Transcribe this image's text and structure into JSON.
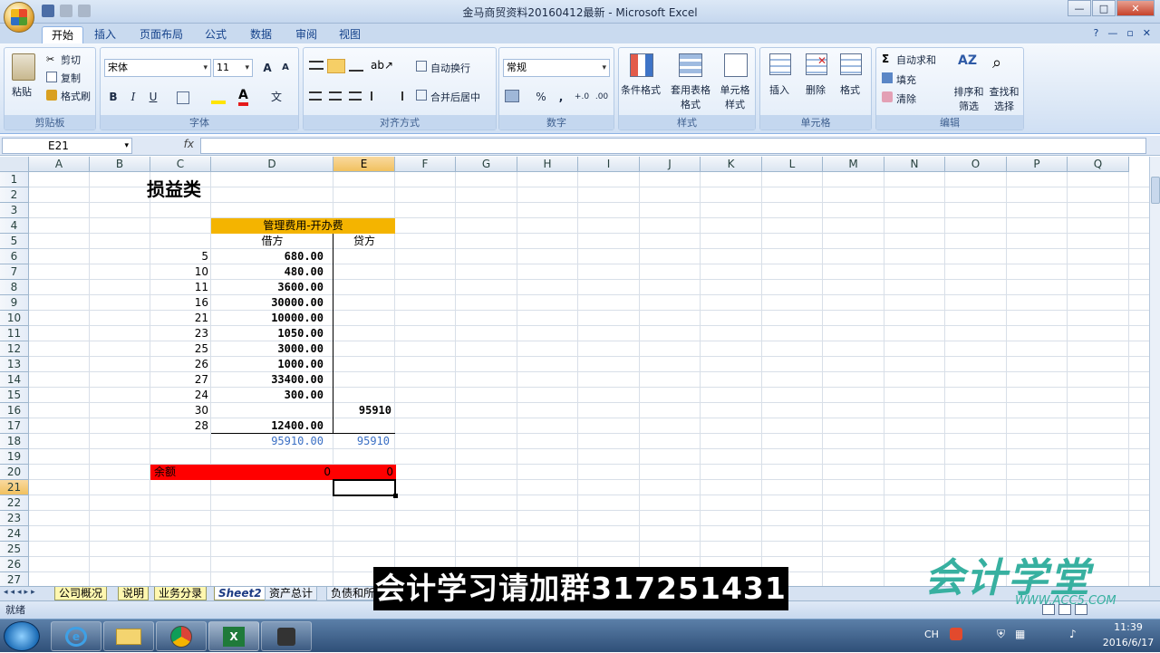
{
  "window": {
    "title": "金马商贸资料20160412最新 - Microsoft Excel",
    "controls": [
      "—",
      "□",
      "✕"
    ]
  },
  "ribbon_tabs": [
    "开始",
    "插入",
    "页面布局",
    "公式",
    "数据",
    "审阅",
    "视图"
  ],
  "ribbon": {
    "clipboard": {
      "paste": "粘贴",
      "cut": "剪切",
      "copy": "复制",
      "format_painter": "格式刷",
      "label": "剪贴板"
    },
    "font": {
      "name": "宋体",
      "size": "11",
      "grow": "A",
      "shrink": "A",
      "bold": "B",
      "italic": "I",
      "underline": "U",
      "label": "字体",
      "phonetic": "文"
    },
    "alignment": {
      "wrap": "自动换行",
      "merge": "合并后居中",
      "label": "对齐方式"
    },
    "number": {
      "format": "常规",
      "percent": "%",
      "comma": ",",
      "inc_dec": "+.0",
      "dec_dec": ".00",
      "label": "数字"
    },
    "styles": {
      "conditional": "条件格式",
      "table": "套用表格格式",
      "cell": "单元格样式",
      "label": "样式"
    },
    "cells": {
      "insert": "插入",
      "delete": "删除",
      "format": "格式",
      "label": "单元格"
    },
    "editing": {
      "autosum": "自动求和",
      "fill": "填充",
      "clear": "清除",
      "sort": "排序和筛选",
      "find": "查找和选择",
      "label": "编辑"
    }
  },
  "formula_bar": {
    "name_box": "E21",
    "fx": "fx",
    "value": ""
  },
  "columns": [
    "A",
    "B",
    "C",
    "D",
    "E",
    "F",
    "G",
    "H",
    "I",
    "J",
    "K",
    "L",
    "M",
    "N",
    "O",
    "P",
    "Q"
  ],
  "rows": [
    "1",
    "2",
    "3",
    "4",
    "5",
    "6",
    "7",
    "8",
    "9",
    "10",
    "11",
    "12",
    "13",
    "14",
    "15",
    "16",
    "17",
    "18",
    "19",
    "20",
    "21",
    "22",
    "23",
    "24",
    "25",
    "26",
    "27"
  ],
  "sheet": {
    "title": "损益类",
    "account_header": "管理费用-开办费",
    "debit_label": "借方",
    "credit_label": "贷方",
    "entries": [
      {
        "ref": "5",
        "debit": "680.00",
        "credit": ""
      },
      {
        "ref": "10",
        "debit": "480.00",
        "credit": ""
      },
      {
        "ref": "11",
        "debit": "3600.00",
        "credit": ""
      },
      {
        "ref": "16",
        "debit": "30000.00",
        "credit": ""
      },
      {
        "ref": "21",
        "debit": "10000.00",
        "credit": ""
      },
      {
        "ref": "23",
        "debit": "1050.00",
        "credit": ""
      },
      {
        "ref": "25",
        "debit": "3000.00",
        "credit": ""
      },
      {
        "ref": "26",
        "debit": "1000.00",
        "credit": ""
      },
      {
        "ref": "27",
        "debit": "33400.00",
        "credit": ""
      },
      {
        "ref": "24",
        "debit": "300.00",
        "credit": ""
      },
      {
        "ref": "30",
        "debit": "",
        "credit": "95910"
      },
      {
        "ref": "28",
        "debit": "12400.00",
        "credit": ""
      }
    ],
    "total_debit": "95910.00",
    "total_credit": "95910",
    "balance_label": "余额",
    "balance_debit": "0",
    "balance_credit": "0"
  },
  "sheet_tabs": [
    "公司概况",
    "说明",
    "业务分录",
    "Sheet2",
    "资产总计",
    "负债和所"
  ],
  "active_sheet": "Sheet2",
  "status": "就绪",
  "overlay_text": "会计学习请加群317251431",
  "watermark": {
    "logo": "会计学堂",
    "url": "WWW.ACC5.COM"
  },
  "taskbar": {
    "lang": "CH",
    "time": "11:39",
    "date": "2016/6/17"
  },
  "colors": {
    "header_fill": "#f4b400",
    "balance_fill": "#ff0000",
    "total_text": "#3a6fc4",
    "selected_col": "#f1c15f"
  }
}
